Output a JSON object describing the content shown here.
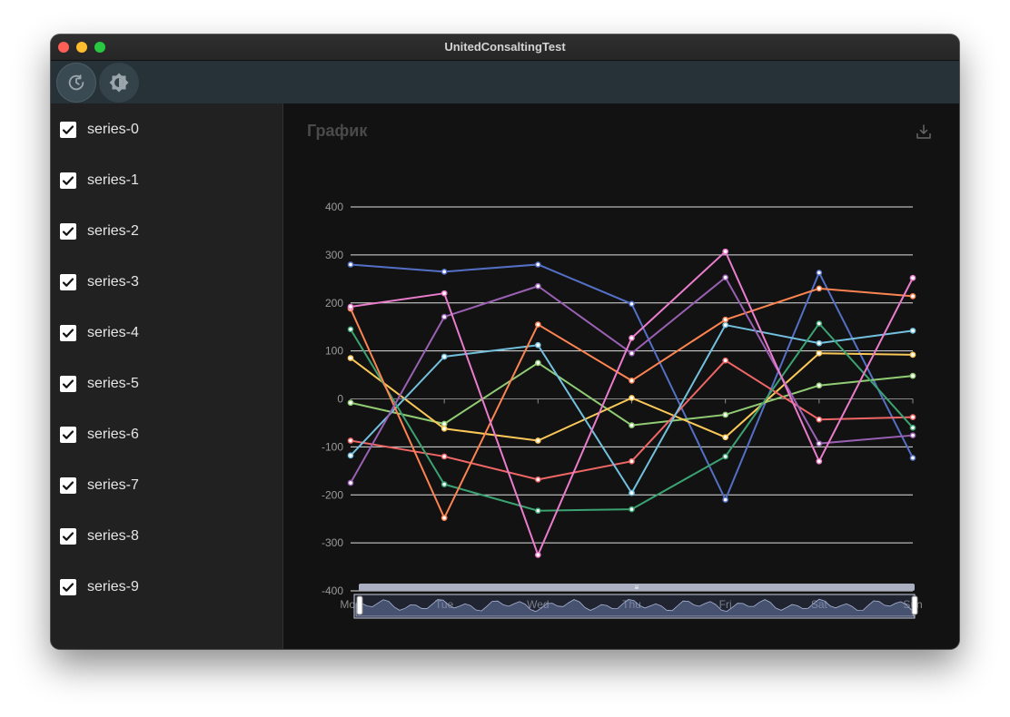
{
  "window": {
    "title": "UnitedConsaltingTest"
  },
  "toolbar": {
    "refresh_icon": "refresh-icon",
    "theme_icon": "theme-toggle-icon"
  },
  "sidebar": {
    "items": [
      {
        "label": "series-0",
        "checked": true
      },
      {
        "label": "series-1",
        "checked": true
      },
      {
        "label": "series-2",
        "checked": true
      },
      {
        "label": "series-3",
        "checked": true
      },
      {
        "label": "series-4",
        "checked": true
      },
      {
        "label": "series-5",
        "checked": true
      },
      {
        "label": "series-6",
        "checked": true
      },
      {
        "label": "series-7",
        "checked": true
      },
      {
        "label": "series-8",
        "checked": true
      },
      {
        "label": "series-9",
        "checked": true
      }
    ]
  },
  "main": {
    "title": "График"
  },
  "colors": {
    "series": [
      "#5470c6",
      "#91cc75",
      "#fac858",
      "#ee6666",
      "#73c0de",
      "#3ba272",
      "#fc8452",
      "#9a60b4",
      "#ea7ccc",
      "#5470c6"
    ]
  },
  "chart_data": {
    "type": "line",
    "categories": [
      "Mon",
      "Tue",
      "Wed",
      "Thu",
      "Fri",
      "Sat",
      "Sun"
    ],
    "ylim": [
      -400,
      400
    ],
    "yticks": [
      400,
      300,
      200,
      100,
      0,
      -100,
      -200,
      -300,
      -400
    ],
    "grid": true,
    "data_zoom": true,
    "series": [
      {
        "values": [
          280,
          265,
          280,
          198,
          -210,
          263,
          -123
        ],
        "color": "#5470c6"
      },
      {
        "values": [
          -8,
          -52,
          75,
          -55,
          -33,
          28,
          48
        ],
        "color": "#91cc75"
      },
      {
        "values": [
          85,
          -62,
          -87,
          2,
          -80,
          95,
          92
        ],
        "color": "#fac858"
      },
      {
        "values": [
          -87,
          -120,
          -168,
          -130,
          80,
          -43,
          -38
        ],
        "color": "#ee6666"
      },
      {
        "values": [
          -118,
          88,
          112,
          -196,
          154,
          116,
          142
        ],
        "color": "#73c0de"
      },
      {
        "values": [
          145,
          -178,
          -233,
          -230,
          -120,
          157,
          -60
        ],
        "color": "#3ba272"
      },
      {
        "values": [
          188,
          -248,
          155,
          38,
          165,
          230,
          214
        ],
        "color": "#fc8452"
      },
      {
        "values": [
          -175,
          171,
          235,
          95,
          253,
          -93,
          -76
        ],
        "color": "#9a60b4"
      },
      {
        "values": [
          192,
          220,
          -325,
          127,
          307,
          -130,
          252
        ],
        "color": "#ea7ccc"
      }
    ]
  }
}
